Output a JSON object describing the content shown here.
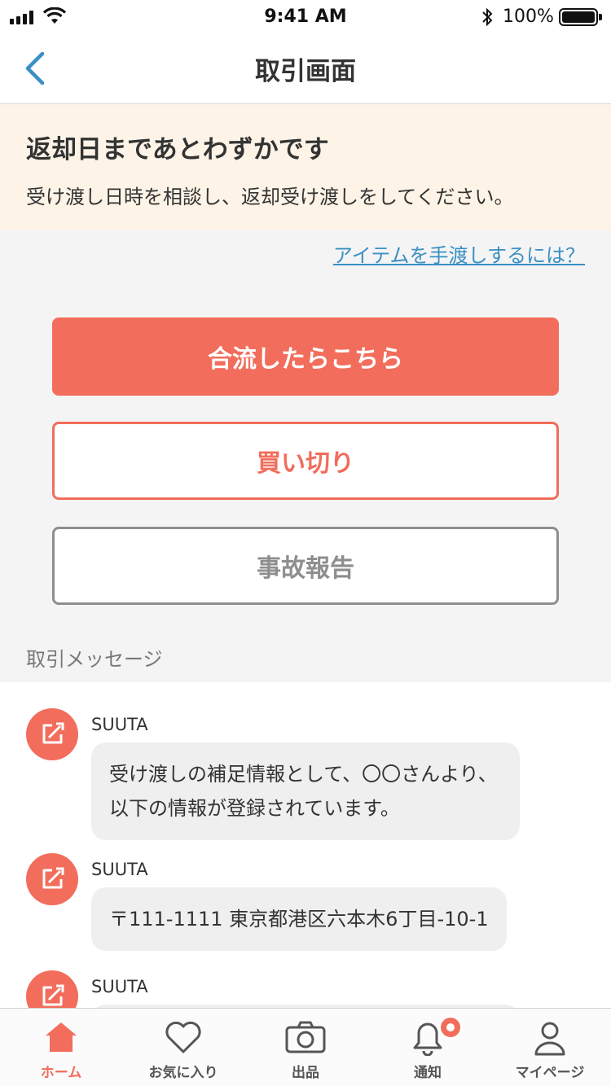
{
  "status_bar": {
    "time": "9:41 AM",
    "battery_percent": "100%"
  },
  "nav": {
    "title": "取引画面",
    "back_icon": "chevron-left-icon"
  },
  "notice": {
    "heading": "返却日まであとわずかです",
    "description": "受け渡し日時を相談し、返却受け渡しをしてください。"
  },
  "help_link": "アイテムを手渡しするには？",
  "actions": {
    "primary_label": "合流したらこちら",
    "buyout_label": "買い切り",
    "accident_label": "事故報告"
  },
  "messages_section_label": "取引メッセージ",
  "messages": [
    {
      "sender": "SUUTA",
      "text": "受け渡しの補足情報として、〇〇さんより、以下の情報が登録されています。"
    },
    {
      "sender": "SUUTA",
      "text": "〒111-1111 東京都港区六本木6丁目-10-1"
    },
    {
      "sender": "SUUTA",
      "text": ""
    }
  ],
  "tabs": [
    {
      "label": "ホーム",
      "icon": "home-icon",
      "active": true
    },
    {
      "label": "お気に入り",
      "icon": "heart-icon",
      "active": false
    },
    {
      "label": "出品",
      "icon": "camera-icon",
      "active": false
    },
    {
      "label": "通知",
      "icon": "bell-icon",
      "active": false,
      "badge": true
    },
    {
      "label": "マイページ",
      "icon": "person-icon",
      "active": false
    }
  ],
  "colors": {
    "accent": "#f26d5b",
    "link": "#3a8fc5",
    "notice_bg": "#fdf4e7",
    "disabled": "#8e8e8e"
  }
}
